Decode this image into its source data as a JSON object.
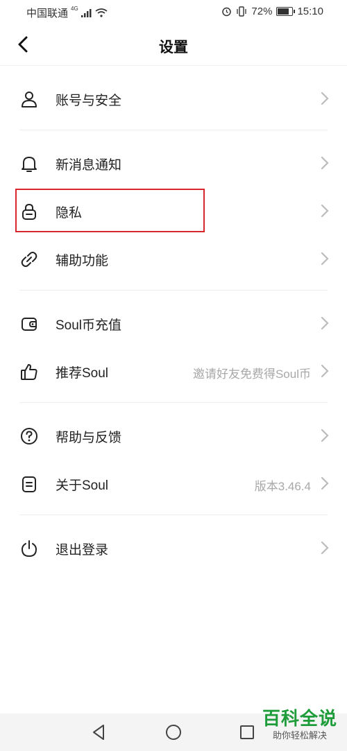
{
  "status_bar": {
    "carrier": "中国联通",
    "network": "4G",
    "battery": "72%",
    "battery_level": 0.72,
    "time": "15:10"
  },
  "header": {
    "title": "设置"
  },
  "items": [
    {
      "label": "账号与安全",
      "hint": "",
      "icon": "user-icon"
    },
    {
      "label": "新消息通知",
      "hint": "",
      "icon": "bell-icon"
    },
    {
      "label": "隐私",
      "hint": "",
      "icon": "lock-icon"
    },
    {
      "label": "辅助功能",
      "hint": "",
      "icon": "link-icon"
    },
    {
      "label": "Soul币充值",
      "hint": "",
      "icon": "wallet-icon"
    },
    {
      "label": "推荐Soul",
      "hint": "邀请好友免费得Soul币",
      "icon": "thumbs-up-icon"
    },
    {
      "label": "帮助与反馈",
      "hint": "",
      "icon": "help-icon"
    },
    {
      "label": "关于Soul",
      "hint": "版本3.46.4",
      "icon": "document-icon"
    },
    {
      "label": "退出登录",
      "hint": "",
      "icon": "power-icon"
    }
  ],
  "watermark": {
    "title": "百科全说",
    "subtitle": "助你轻松解决"
  },
  "colors": {
    "highlight": "#d9262c",
    "watermark": "#1e9c3a"
  }
}
